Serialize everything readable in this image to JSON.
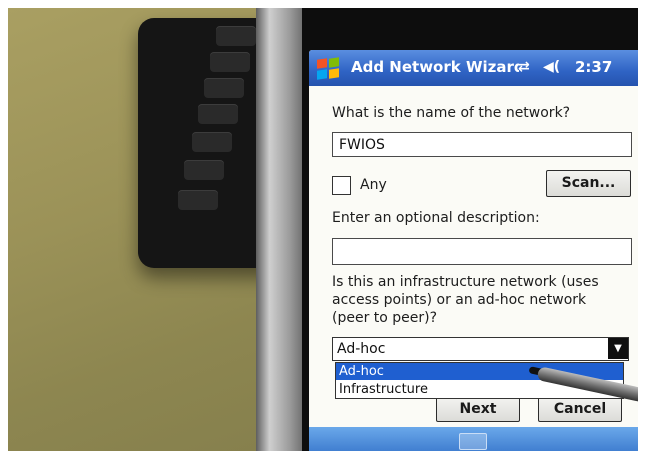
{
  "window": {
    "title": "Add Network Wizard",
    "clock": "2:37"
  },
  "form": {
    "network_name_question": "What is the name of the network?",
    "network_name_value": "FWIOS",
    "any_label": "Any",
    "scan_label": "Scan...",
    "description_question": "Enter an optional description:",
    "description_value": "",
    "type_question_line1": "Is this an infrastructure network (uses",
    "type_question_line2": "access points) or an ad-hoc network",
    "type_question_line3": "(peer to peer)?",
    "network_type_selected": "Ad-hoc",
    "network_type_options": [
      "Ad-hoc",
      "Infrastructure"
    ]
  },
  "buttons": {
    "next_label": "Next",
    "cancel_label": "Cancel"
  },
  "icons": {
    "start": "windows-flag-icon",
    "connectivity": "connectivity-arrows-icon",
    "volume": "speaker-icon",
    "dropdown": "chevron-down-icon",
    "keyboard": "keyboard-icon"
  },
  "colors": {
    "titlebar": "#2f63c4",
    "selection": "#1f5fd0",
    "bottom_bar": "#3a78cc"
  }
}
